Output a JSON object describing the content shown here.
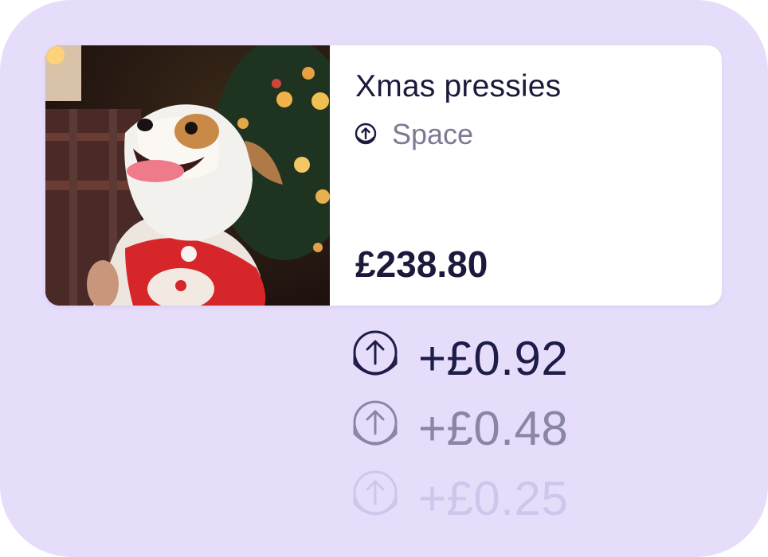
{
  "pot": {
    "title": "Xmas pressies",
    "type_label": "Space",
    "type_icon": "round-up-coin-icon",
    "balance": "£238.80",
    "photo_icon": "dog-in-christmas-outfit-photo"
  },
  "increments": [
    {
      "amount": "+£0.92",
      "icon": "round-up-coins-icon"
    },
    {
      "amount": "+£0.48",
      "icon": "round-up-coins-icon"
    },
    {
      "amount": "+£0.25",
      "icon": "round-up-coins-icon"
    }
  ],
  "colors": {
    "panel_background": "#e6ddfb",
    "card_background": "#ffffff",
    "text_primary": "#1b1a3d",
    "text_secondary": "#7d7a94"
  }
}
